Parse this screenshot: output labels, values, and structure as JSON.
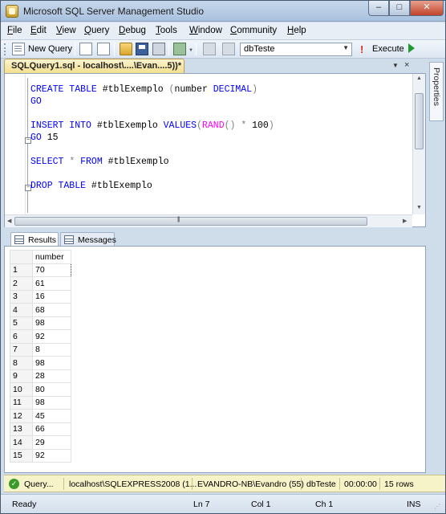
{
  "window": {
    "title": "Microsoft SQL Server Management Studio",
    "min_glyph": "–",
    "max_glyph": "□",
    "close_glyph": "✕"
  },
  "menu": [
    {
      "label": "File",
      "ul": "F",
      "rest": "ile"
    },
    {
      "label": "Edit",
      "ul": "E",
      "rest": "dit"
    },
    {
      "label": "View",
      "ul": "V",
      "rest": "iew"
    },
    {
      "label": "Query",
      "ul": "Q",
      "rest": "uery"
    },
    {
      "label": "Debug",
      "ul": "D",
      "rest": "ebug"
    },
    {
      "label": "Tools",
      "ul": "T",
      "rest": "ools"
    },
    {
      "label": "Window",
      "ul": "W",
      "rest": "indow"
    },
    {
      "label": "Community",
      "ul": "C",
      "rest": "ommunity"
    },
    {
      "label": "Help",
      "ul": "H",
      "rest": "elp"
    }
  ],
  "toolbar": {
    "new_query_label": "New Query",
    "database": "dbTeste",
    "execute_label": "Execute",
    "execute_glyph": "!",
    "dropdown_glyph": "▼"
  },
  "document_tab": {
    "label": "SQLQuery1.sql - localhost\\....\\Evan....5))*",
    "close_glyph": "×",
    "list_glyph": "▼"
  },
  "side_panel": {
    "label": "Properties"
  },
  "editor": {
    "lines": [
      {
        "parts": [
          {
            "t": "CREATE TABLE ",
            "c": "kw"
          },
          {
            "t": "#tblExemplo ",
            "c": "id"
          },
          {
            "t": "(",
            "c": "op"
          },
          {
            "t": "number ",
            "c": "id"
          },
          {
            "t": "DECIMAL",
            "c": "kw"
          },
          {
            "t": ")",
            "c": "op"
          }
        ]
      },
      {
        "parts": [
          {
            "t": "GO",
            "c": "kw"
          }
        ]
      },
      {
        "parts": []
      },
      {
        "parts": [
          {
            "t": "INSERT INTO ",
            "c": "kw"
          },
          {
            "t": "#tblExemplo ",
            "c": "id"
          },
          {
            "t": "VALUES",
            "c": "kw"
          },
          {
            "t": "(",
            "c": "op"
          },
          {
            "t": "RAND",
            "c": "fn"
          },
          {
            "t": "() ",
            "c": "op"
          },
          {
            "t": "* ",
            "c": "op"
          },
          {
            "t": "100",
            "c": "id"
          },
          {
            "t": ")",
            "c": "op"
          }
        ]
      },
      {
        "parts": [
          {
            "t": "GO ",
            "c": "kw"
          },
          {
            "t": "15",
            "c": "id"
          }
        ]
      },
      {
        "parts": []
      },
      {
        "parts": [
          {
            "t": "SELECT ",
            "c": "kw"
          },
          {
            "t": "* ",
            "c": "op"
          },
          {
            "t": "FROM ",
            "c": "kw"
          },
          {
            "t": "#tblExemplo",
            "c": "id"
          }
        ]
      },
      {
        "parts": []
      },
      {
        "parts": [
          {
            "t": "DROP TABLE ",
            "c": "kw"
          },
          {
            "t": "#tblExemplo",
            "c": "id"
          }
        ]
      }
    ]
  },
  "results_tabs": [
    {
      "label": "Results"
    },
    {
      "label": "Messages"
    }
  ],
  "grid": {
    "column": "number",
    "rows": [
      {
        "n": "1",
        "v": "70"
      },
      {
        "n": "2",
        "v": "61"
      },
      {
        "n": "3",
        "v": "16"
      },
      {
        "n": "4",
        "v": "68"
      },
      {
        "n": "5",
        "v": "98"
      },
      {
        "n": "6",
        "v": "92"
      },
      {
        "n": "7",
        "v": "8"
      },
      {
        "n": "8",
        "v": "98"
      },
      {
        "n": "9",
        "v": "28"
      },
      {
        "n": "10",
        "v": "80"
      },
      {
        "n": "11",
        "v": "98"
      },
      {
        "n": "12",
        "v": "45"
      },
      {
        "n": "13",
        "v": "66"
      },
      {
        "n": "14",
        "v": "29"
      },
      {
        "n": "15",
        "v": "92"
      }
    ]
  },
  "query_status": {
    "state": "Query...",
    "server": "localhost\\SQLEXPRESS2008 (1...",
    "user": "EVANDRO-NB\\Evandro (55)",
    "database": "dbTeste",
    "elapsed": "00:00:00",
    "rows": "15 rows"
  },
  "statusbar": {
    "ready": "Ready",
    "line": "Ln 7",
    "col": "Col 1",
    "ch": "Ch 1",
    "mode": "INS"
  },
  "colors": {
    "keyword": "#0000ff",
    "function": "#ff00ff",
    "operator": "#808080",
    "success": "#3a9a2a",
    "tab_active": "#f3df8e"
  }
}
